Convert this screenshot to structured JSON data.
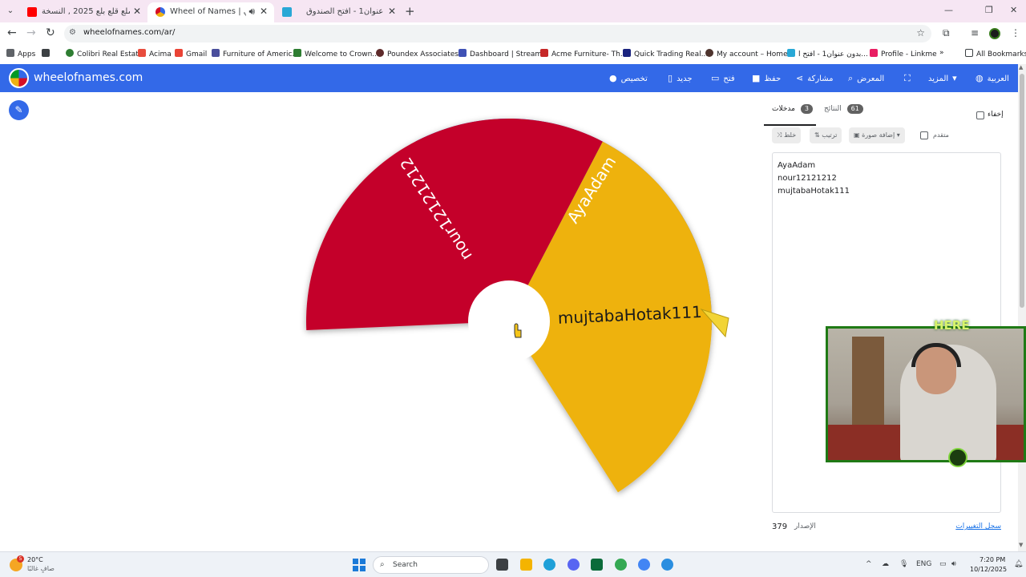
{
  "browser": {
    "tabs": [
      {
        "title": "مجوز شلع قلع بلع 2025 , النسخة",
        "icon": "youtube-icon"
      },
      {
        "title": "Wheel of Names | العشوائي",
        "icon": "wheel-of-names-icon"
      },
      {
        "title": "بدون عنوان1 - افتح الصندوق",
        "icon": "wordwall-icon"
      }
    ],
    "url": "wheelofnames.com/ar/",
    "bookmarks": [
      "Apps",
      "Colibri Real Estate",
      "Acima",
      "Gmail",
      "Furniture of Americ...",
      "Welcome to Crown...",
      "Poundex Associates...",
      "Dashboard | Stream...",
      "Acme Furniture- Th...",
      "Quick Trading Real...",
      "My account – Home...",
      "بدون عنوان1 - افتح ا...",
      "Profile - Linkme"
    ],
    "all_bookmarks": "All Bookmarks"
  },
  "app": {
    "brand": "wheelofnames.com",
    "menu": {
      "customize": "تخصيص",
      "new": "جديد",
      "open": "فتح",
      "save": "حفظ",
      "share": "مشاركة",
      "gallery": "المعرض",
      "more": "المزيد",
      "language": "العربية"
    }
  },
  "wheel": {
    "segments": [
      {
        "name": "AyaAdam",
        "color": "#3369e8"
      },
      {
        "name": "mujtabaHotak111",
        "color": "#eeb211"
      },
      {
        "name": "nour12121212",
        "color": "#c4002a"
      }
    ],
    "pointer_color": "#f2d435"
  },
  "panel": {
    "tab_entries": "مدخلات",
    "tab_entries_count": "3",
    "tab_results": "النتائج",
    "tab_results_count": "61",
    "hide_label": "إخفاء",
    "shuffle_label": "خلط",
    "sort_label": "ترتيب",
    "add_image_label": "إضافة صورة",
    "advanced_label": "متقدم",
    "entries": [
      "AyaAdam",
      "nour12121212",
      "mujtabaHotak111"
    ],
    "version_label": "الإصدار",
    "version_number": "379",
    "changelog_label": "سجل التغييرات"
  },
  "overlay": {
    "label": "HERE"
  },
  "taskbar": {
    "weather_temp": "20°C",
    "weather_desc": "صافٍ غالبًا",
    "weather_badge": "5",
    "search_label": "Search",
    "language": "ENG",
    "time": "7:20 PM",
    "date": "10/12/2025"
  }
}
